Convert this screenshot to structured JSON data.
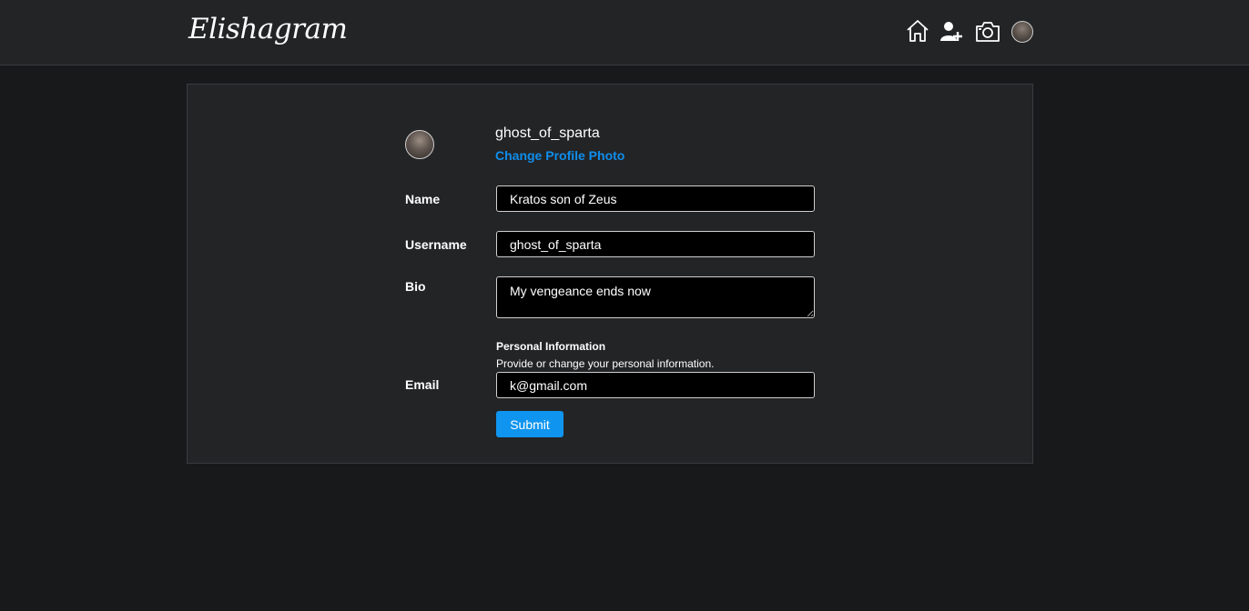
{
  "header": {
    "logo_text": "Elishagram",
    "icons": [
      "home-icon",
      "add-user-icon",
      "camera-icon",
      "profile-avatar"
    ]
  },
  "profile": {
    "username": "ghost_of_sparta",
    "change_photo_label": "Change Profile Photo"
  },
  "form": {
    "name_label": "Name",
    "name_value": "Kratos son of Zeus",
    "username_label": "Username",
    "username_value": "ghost_of_sparta",
    "bio_label": "Bio",
    "bio_value": "My vengeance ends now",
    "personal_info_title": "Personal Information",
    "personal_info_subtitle": "Provide or change your personal information.",
    "email_label": "Email",
    "email_value": "k@gmail.com",
    "submit_label": "Submit"
  },
  "colors": {
    "background": "#18191b",
    "panel": "#232426",
    "accent_link": "#0f8eec",
    "button": "#0f95ef"
  }
}
